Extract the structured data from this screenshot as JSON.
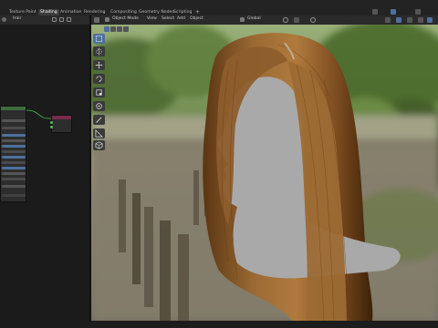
{
  "workspace_tabs": [
    {
      "label": "Texture Paint",
      "active": false
    },
    {
      "label": "Shading",
      "active": true
    },
    {
      "label": "Animation",
      "active": false
    },
    {
      "label": "Rendering",
      "active": false
    },
    {
      "label": "Compositing",
      "active": false
    },
    {
      "label": "Geometry Nodes",
      "active": false
    },
    {
      "label": "Scripting",
      "active": false
    }
  ],
  "add_workspace_label": "+",
  "shader_editor": {
    "object_label": "Hair"
  },
  "viewport_header": {
    "mode": "Object Mode",
    "menus": [
      "View",
      "Select",
      "Add",
      "Object"
    ],
    "transform_orientation": "Global"
  },
  "toolbar_tools": [
    {
      "icon": "select-box-icon",
      "active": true
    },
    {
      "icon": "cursor-icon",
      "active": false
    },
    {
      "icon": "move-icon",
      "active": false
    },
    {
      "icon": "rotate-icon",
      "active": false
    },
    {
      "icon": "scale-icon",
      "active": false
    },
    {
      "icon": "transform-icon",
      "active": false
    },
    {
      "icon": "annotate-icon",
      "active": false
    },
    {
      "icon": "measure-icon",
      "active": false
    },
    {
      "icon": "add-cube-icon",
      "active": false
    }
  ],
  "colors": {
    "accent": "#4f6f9f",
    "panel_bg": "#1b1b1b",
    "header_bg": "#2a2a2a",
    "hair": "#8a5a28",
    "mannequin": "#a8a8a8"
  }
}
